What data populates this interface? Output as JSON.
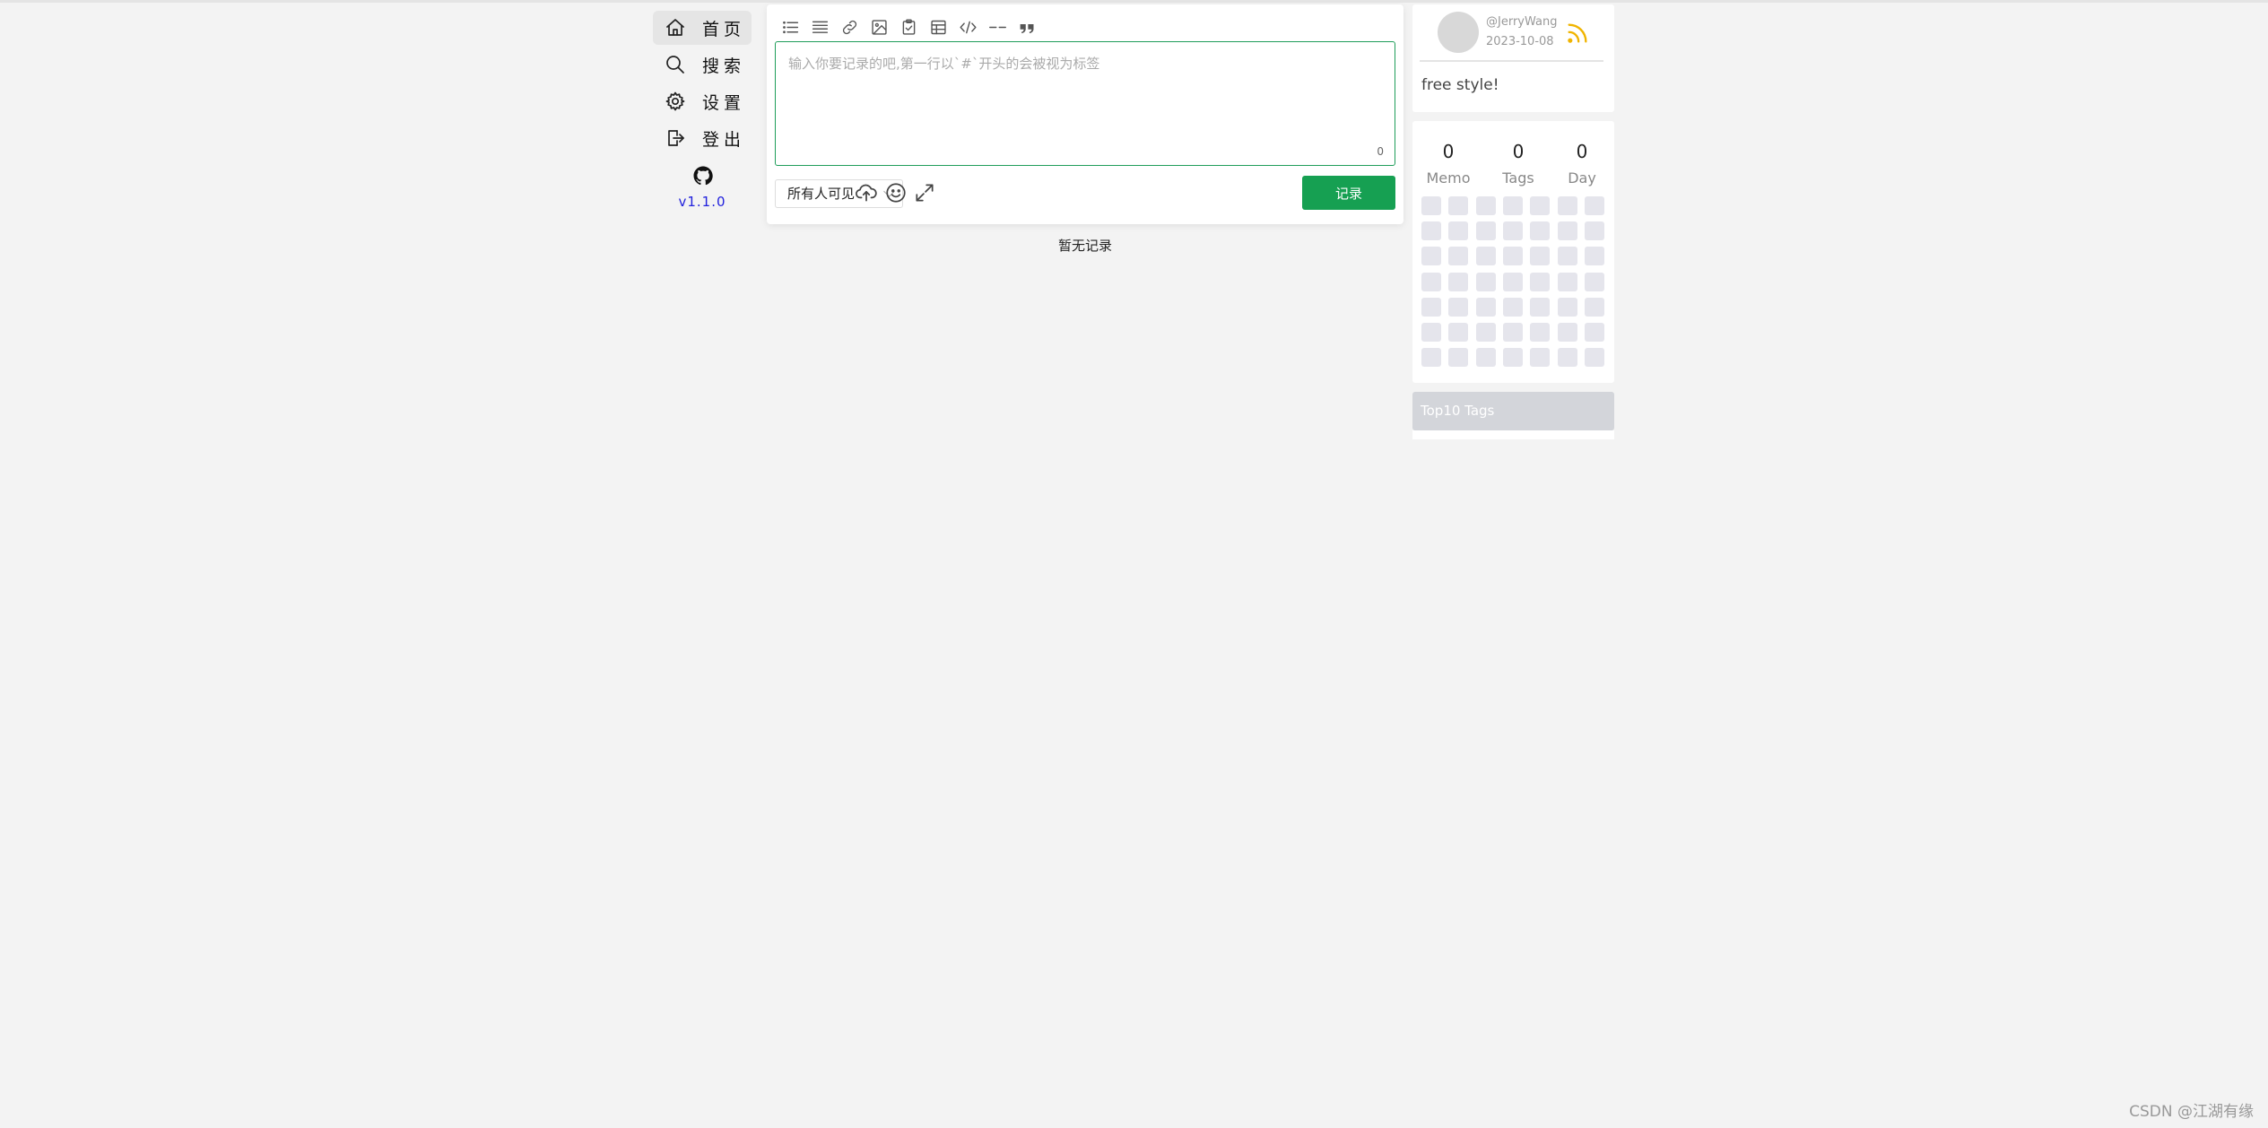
{
  "nav": {
    "items": [
      {
        "label": "首页",
        "icon": "home-icon"
      },
      {
        "label": "搜索",
        "icon": "search-icon"
      },
      {
        "label": "设置",
        "icon": "gear-icon"
      },
      {
        "label": "登出",
        "icon": "logout-icon"
      }
    ],
    "github_icon": "github-icon",
    "version": "v1.1.0"
  },
  "editor": {
    "toolbar_icons": [
      "unordered-list-icon",
      "ordered-list-icon",
      "link-icon",
      "image-icon",
      "checklist-icon",
      "table-icon",
      "code-icon",
      "divider-icon",
      "quote-icon"
    ],
    "placeholder": "输入你要记录的吧,第一行以`#`开头的会被视为标签",
    "char_count": "0",
    "visibility": "所有人可见",
    "submit_label": "记录",
    "accent_color": "#16a052"
  },
  "feed": {
    "empty_text": "暂无记录"
  },
  "profile": {
    "username": "@JerryWang",
    "date": "2023-10-08",
    "bio": "free style!"
  },
  "stats": {
    "memo": {
      "value": "0",
      "label": "Memo"
    },
    "tags": {
      "value": "0",
      "label": "Tags"
    },
    "day": {
      "value": "0",
      "label": "Day"
    }
  },
  "top_tags": {
    "title": "Top10 Tags"
  },
  "watermark": "CSDN @江湖有缘"
}
